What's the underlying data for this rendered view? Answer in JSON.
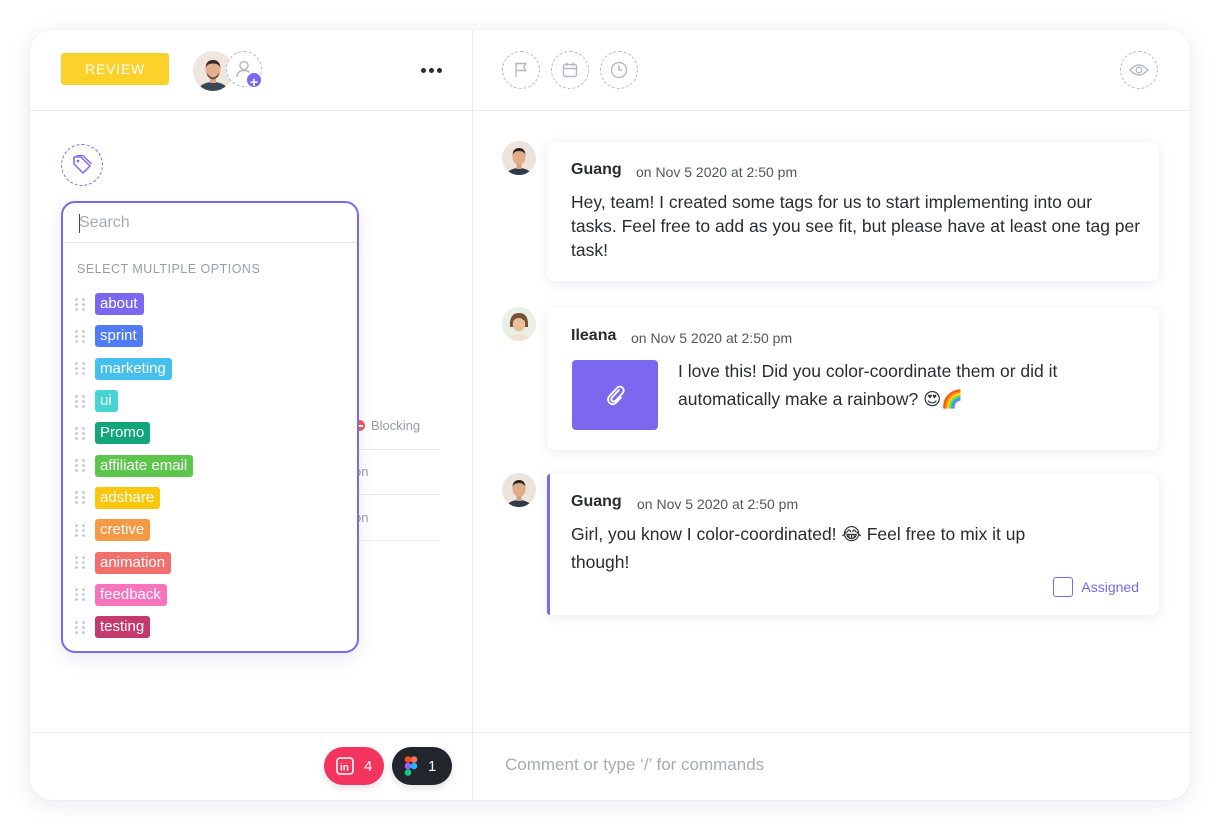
{
  "header": {
    "status_label": "REVIEW"
  },
  "tags_dropdown": {
    "search_placeholder": "Search",
    "section_label": "SELECT MULTIPLE OPTIONS",
    "tags": [
      {
        "label": "about",
        "color": "#7b68ee"
      },
      {
        "label": "sprint",
        "color": "#4f7cf6"
      },
      {
        "label": "marketing",
        "color": "#45c0ee"
      },
      {
        "label": "ui",
        "color": "#44d4d4"
      },
      {
        "label": "Promo",
        "color": "#12a77a"
      },
      {
        "label": "affiliate email",
        "color": "#5cc54b"
      },
      {
        "label": "adshare",
        "color": "#fbc70d"
      },
      {
        "label": "cretive",
        "color": "#f69944"
      },
      {
        "label": "animation",
        "color": "#f36f6b"
      },
      {
        "label": "feedback",
        "color": "#f874bf"
      },
      {
        "label": "testing",
        "color": "#c5396d"
      }
    ]
  },
  "relationships": {
    "blocking_label": "Blocking",
    "row2_label": "on",
    "row3_label": "on"
  },
  "integrations": {
    "invision_count": "4",
    "figma_count": "1"
  },
  "comments": [
    {
      "author": "Guang",
      "time": "on Nov 5 2020 at 2:50 pm",
      "text": "Hey, team! I created some tags for us to start implementing into our tasks. Feel free to add as you see fit, but please have at least one tag per task!"
    },
    {
      "author": "Ileana",
      "time": "on Nov 5 2020 at 2:50 pm",
      "text": "I love this! Did you color-coordinate them or did it automatically make a rainbow? 😍🌈"
    },
    {
      "author": "Guang",
      "time": "on Nov 5 2020 at 2:50 pm",
      "text": "Girl, you know I color-coordinated! 😂 Feel free to mix it up though!",
      "assigned_label": "Assigned"
    }
  ],
  "comment_box": {
    "placeholder": "Comment or type ‘/’ for commands"
  },
  "colors": {
    "accent": "#7b68ee",
    "status_review": "#fcd12a",
    "invision": "#f2345e",
    "figma_badge": "#22252b"
  }
}
